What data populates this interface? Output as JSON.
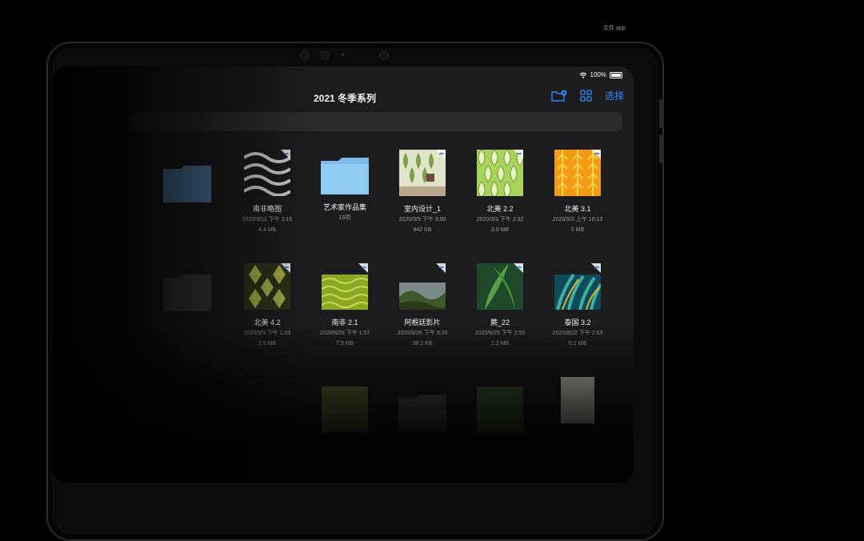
{
  "caption": "文件 app",
  "status_bar": {
    "battery": "100%"
  },
  "nav": {
    "title": "2021 冬季系列",
    "select_label": "选择"
  },
  "items": [
    {
      "name": "南非略图",
      "date": "2020/9/12 下午 3:16",
      "size": "4.4 MB",
      "kind": "pattern-black"
    },
    {
      "name": "艺术家作品集",
      "date": "19项",
      "size": "",
      "kind": "folder"
    },
    {
      "name": "室内设计_1",
      "date": "2020/9/9 下午 3:00",
      "size": "942 KB",
      "kind": "room"
    },
    {
      "name": "北美 2.2",
      "date": "2020/9/3 下午 2:32",
      "size": "3.9 MB",
      "kind": "pattern-green"
    },
    {
      "name": "北美 3.1",
      "date": "2020/9/3 上午 10:13",
      "size": "5 MB",
      "kind": "pattern-orange"
    },
    {
      "name": "北美 4.2",
      "date": "2020/9/3 下午 1:08",
      "size": "2.5 MB",
      "kind": "pattern-olive"
    },
    {
      "name": "南非 2.1",
      "date": "2020/8/28 下午 1:57",
      "size": "7.5 MB",
      "kind": "pattern-lime"
    },
    {
      "name": "阿根廷影片",
      "date": "2020/8/26 下午 3:28",
      "size": "38.2 KB",
      "kind": "landscape"
    },
    {
      "name": "蕨_22",
      "date": "2020/8/25 下午 2:55",
      "size": "1.2 MB",
      "kind": "leaf"
    },
    {
      "name": "泰国 3.2",
      "date": "2020/8/22 下午 2:03",
      "size": "5.1 MB",
      "kind": "pattern-teal"
    }
  ]
}
